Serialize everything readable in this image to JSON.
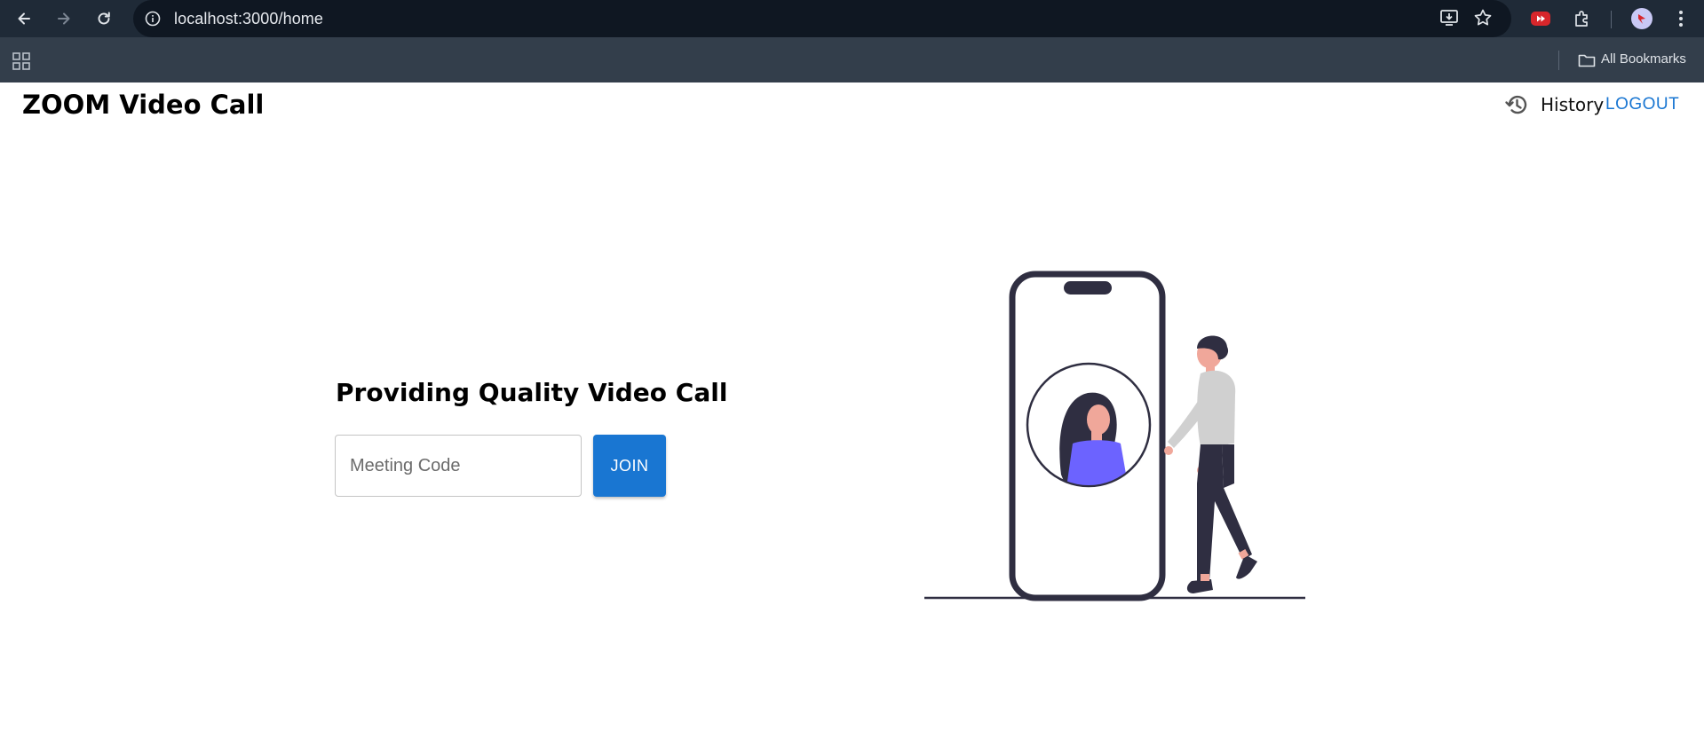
{
  "browser": {
    "url": "localhost:3000/home",
    "bookmarks_label": "All Bookmarks",
    "icons": [
      "back-icon",
      "forward-icon",
      "reload-icon",
      "site-info-icon",
      "install-app-icon",
      "star-icon",
      "extension-red-icon",
      "extensions-puzzle-icon",
      "profile-avatar",
      "more-menu-icon",
      "apps-grid-icon",
      "folder-icon"
    ]
  },
  "header": {
    "title": "ZOOM Video Call",
    "history_label": "History",
    "logout_label": "LOGOUT"
  },
  "main": {
    "heading": "Providing Quality Video Call",
    "meeting_input": {
      "value": "",
      "placeholder": "Meeting Code"
    },
    "join_label": "JOIN"
  },
  "colors": {
    "accent": "#1976d2",
    "chrome_top": "#1f2a37",
    "chrome_bookmarks": "#333e4b",
    "illustration_purple": "#6c63ff",
    "illustration_dark": "#2f2e41"
  }
}
